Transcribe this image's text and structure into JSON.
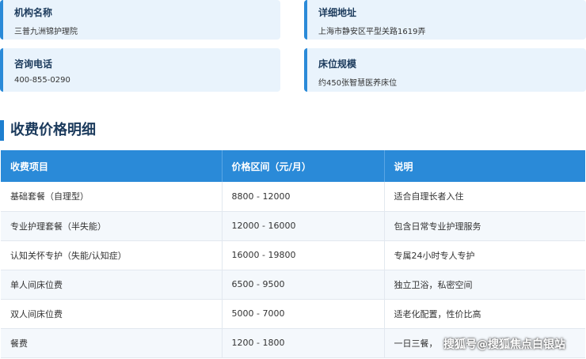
{
  "cards": [
    {
      "label": "机构名称",
      "value": "三普九洲锦护理院"
    },
    {
      "label": "详细地址",
      "value": "上海市静安区平型关路1619弄"
    },
    {
      "label": "咨询电话",
      "value": "400-855-0290"
    },
    {
      "label": "床位规模",
      "value": "约450张智慧医养床位"
    }
  ],
  "section_title": "收费价格明细",
  "table": {
    "headers": [
      "收费项目",
      "价格区间（元/月）",
      "说明"
    ],
    "rows": [
      [
        "基础套餐（自理型）",
        "8800 - 12000",
        "适合自理长者入住"
      ],
      [
        "专业护理套餐（半失能）",
        "12000 - 16000",
        "包含日常专业护理服务"
      ],
      [
        "认知关怀专护（失能/认知症）",
        "16000 - 19800",
        "专属24小时专人专护"
      ],
      [
        "单人间床位费",
        "6500 - 9500",
        "独立卫浴，私密空间"
      ],
      [
        "双人间床位费",
        "5000 - 7000",
        "适老化配置，性价比高"
      ],
      [
        "餐费",
        "1200 - 1800",
        "一日三餐，"
      ]
    ]
  },
  "watermark": "搜狐号@搜狐焦点白银站"
}
